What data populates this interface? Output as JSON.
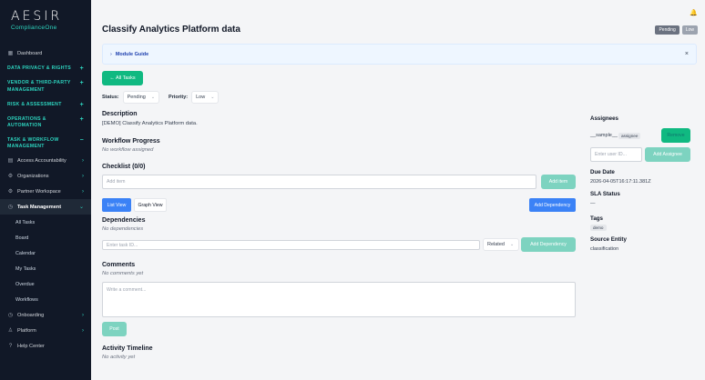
{
  "sidebar": {
    "brand": "AESIR",
    "brand_sub": "ComplianceOne",
    "dashboard": "Dashboard",
    "sections": [
      {
        "label": "DATA PRIVACY & RIGHTS"
      },
      {
        "label": "VENDOR & THIRD-PARTY MANAGEMENT"
      },
      {
        "label": "RISK & ASSESSMENT"
      },
      {
        "label": "OPERATIONS & AUTOMATION"
      },
      {
        "label": "TASK & WORKFLOW MANAGEMENT"
      }
    ],
    "items": {
      "access_accountability": "Access Accountability",
      "organizations": "Organizations",
      "partner_workspace": "Partner Workspace",
      "task_management": "Task Management"
    },
    "task_subs": [
      "All Tasks",
      "Board",
      "Calendar",
      "My Tasks",
      "Overdue",
      "Workflows"
    ],
    "onboarding": "Onboarding",
    "platform": "Platform",
    "help_center": "Help Center"
  },
  "header": {
    "title": "Classify Analytics Platform data",
    "badge_status": "Pending",
    "badge_priority": "Low"
  },
  "guide": {
    "label": "Module Guide",
    "close": "×"
  },
  "back_button": "← All Tasks",
  "status": {
    "label": "Status:",
    "value": "Pending"
  },
  "priority": {
    "label": "Priority:",
    "value": "Low"
  },
  "description": {
    "title": "Description",
    "text": "[DEMO] Classify Analytics Platform data."
  },
  "workflow": {
    "title": "Workflow Progress",
    "empty": "No workflow assigned"
  },
  "checklist": {
    "title": "Checklist (0/0)",
    "placeholder": "Add item",
    "add_button": "Add item"
  },
  "views": {
    "list": "List View",
    "graph": "Graph View",
    "add_dependency": "Add Dependency"
  },
  "dependencies": {
    "title": "Dependencies",
    "empty": "No dependencies",
    "placeholder": "Enter task ID...",
    "type": "Related",
    "add_button": "Add Dependency"
  },
  "comments": {
    "title": "Comments",
    "empty": "No comments yet",
    "placeholder": "Write a comment...",
    "post": "Post"
  },
  "activity": {
    "title": "Activity Timeline",
    "empty": "No activity yet"
  },
  "right_panel": {
    "assignees_title": "Assignees",
    "assignee_name": "__sample__",
    "assignee_role": "assignee",
    "remove_button": "Remove",
    "user_placeholder": "Enter user ID...",
    "add_assignee": "Add Assignee",
    "due_title": "Due Date",
    "due_value": "2026-04-05T16:17:11.381Z",
    "sla_title": "SLA Status",
    "sla_value": "—",
    "tags_title": "Tags",
    "tag": "demo",
    "source_title": "Source Entity",
    "source_value": "classification"
  }
}
